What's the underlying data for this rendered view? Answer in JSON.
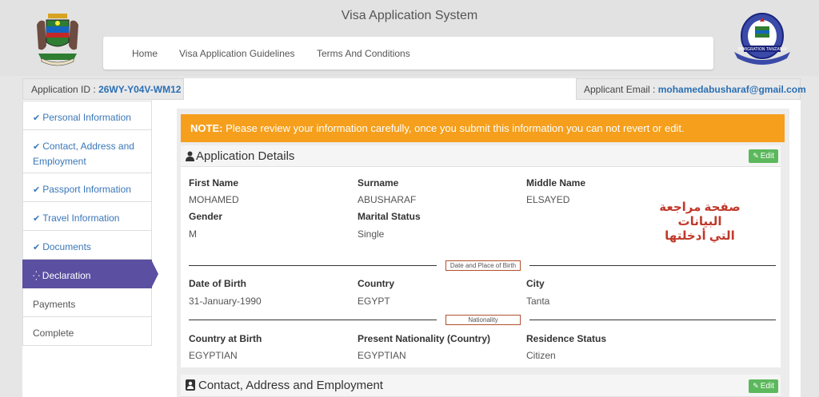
{
  "header": {
    "title": "Visa Application System",
    "nav": [
      "Home",
      "Visa Application Guidelines",
      "Terms And Conditions"
    ],
    "logo_right_text": "IMMIGRATION TANZANIA"
  },
  "appbar": {
    "app_id_label": "Application ID :",
    "app_id_value": "26WY-Y04V-WM12",
    "email_label": "Applicant Email :",
    "email_value": "mohamedabusharaf@gmail.com"
  },
  "sidebar": {
    "items": [
      {
        "label": "Personal Information",
        "icon": "check-icon"
      },
      {
        "label": "Contact, Address and Employment",
        "icon": "check-icon"
      },
      {
        "label": "Passport Information",
        "icon": "check-icon"
      },
      {
        "label": "Travel Information",
        "icon": "check-icon"
      },
      {
        "label": "Documents",
        "icon": "check-icon"
      },
      {
        "label": "Declaration",
        "icon": "spinner-icon"
      },
      {
        "label": "Payments"
      },
      {
        "label": "Complete"
      }
    ]
  },
  "note": {
    "label": "NOTE:",
    "text": " Please review your information carefully, once you submit this information you can not revert or edit."
  },
  "application_details": {
    "title": "Application Details",
    "edit_label": "Edit",
    "first_name": {
      "label": "First Name",
      "value": "MOHAMED"
    },
    "surname": {
      "label": "Surname",
      "value": "ABUSHARAF"
    },
    "middle_name": {
      "label": "Middle Name",
      "value": "ELSAYED"
    },
    "gender": {
      "label": "Gender",
      "value": "M"
    },
    "marital_status": {
      "label": "Marital Status",
      "value": "Single"
    },
    "dob_section": "Date and Place of Birth",
    "dob": {
      "label": "Date of Birth",
      "value": "31-January-1990"
    },
    "country": {
      "label": "Country",
      "value": "EGYPT"
    },
    "city": {
      "label": "City",
      "value": "Tanta"
    },
    "nationality_section": "Nationality",
    "country_at_birth": {
      "label": "Country at Birth",
      "value": "EGYPTIAN"
    },
    "present_nationality": {
      "label": "Present Nationality (Country)",
      "value": "EGYPTIAN"
    },
    "residence_status": {
      "label": "Residence Status",
      "value": "Citizen"
    }
  },
  "contact_section": {
    "title": "Contact, Address and Employment",
    "edit_label": "Edit"
  },
  "annotation": {
    "line1": "صفحة مراجعة البيانات",
    "line2": "التي أدخلتها"
  },
  "colors": {
    "accent": "#5b4fa1",
    "link": "#2a6fb5",
    "note_bg": "#f59f1c",
    "edit_btn": "#5cb85c"
  }
}
